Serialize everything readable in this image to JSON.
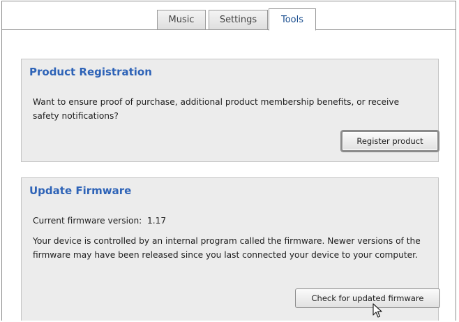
{
  "tabs": {
    "music": "Music",
    "settings": "Settings",
    "tools": "Tools",
    "active": "Tools"
  },
  "registration": {
    "title": "Product Registration",
    "description": "Want to ensure proof of purchase, additional product membership benefits, or receive safety notifications?",
    "button": "Register product"
  },
  "firmware": {
    "title": "Update Firmware",
    "version_label": "Current firmware version:",
    "version_value": "1.17",
    "description": "Your device is controlled by an internal program called the firmware. Newer versions of the firmware may have been released since you last connected your device to your computer.",
    "button": "Check for updated firmware"
  },
  "colors": {
    "accent_title": "#2e63b7",
    "active_tab_text": "#1a4e8f",
    "panel_background": "#ececec"
  },
  "icons": {
    "cursor": "mouse-pointer-icon"
  }
}
